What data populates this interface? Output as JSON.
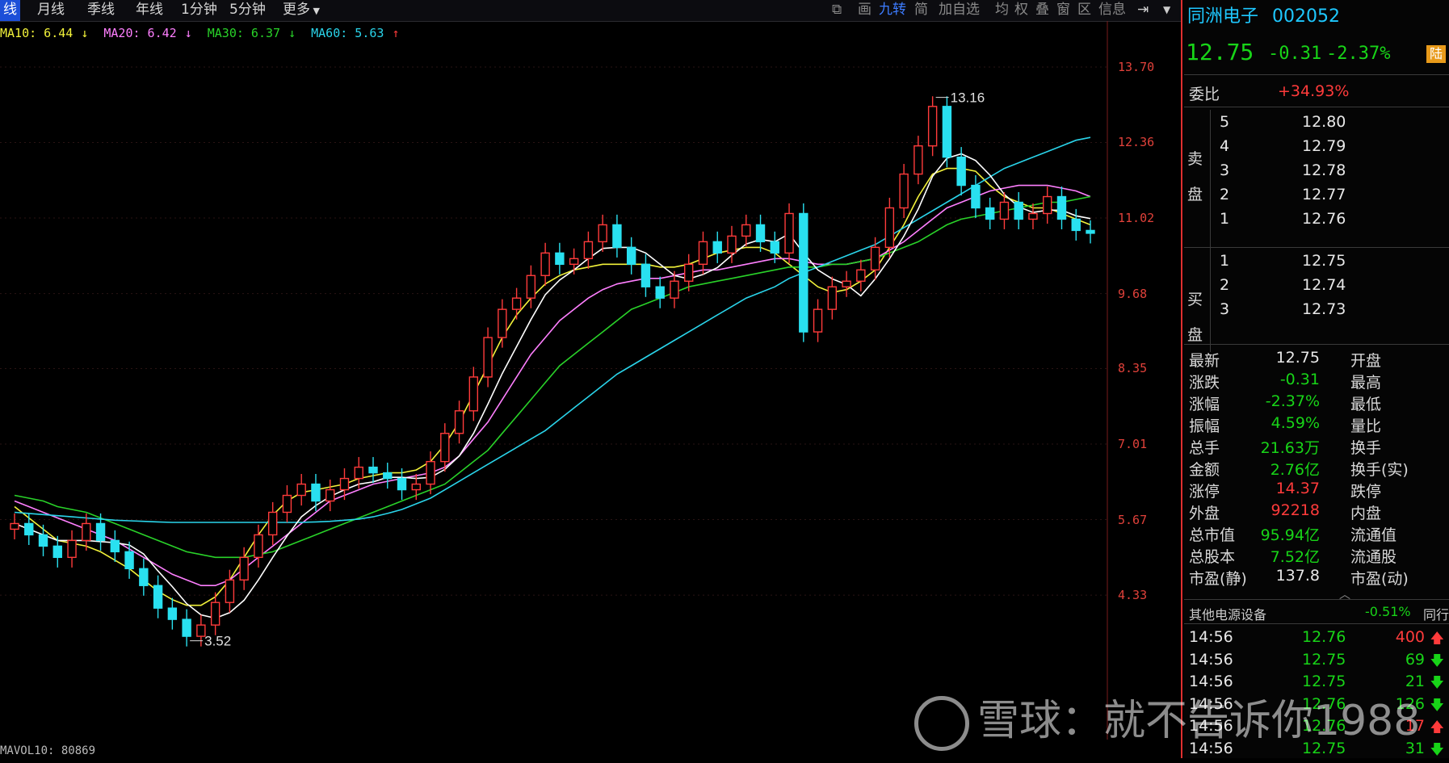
{
  "toolbar": {
    "tabs": [
      "线",
      "月线",
      "季线",
      "年线",
      "1分钟",
      "5分钟",
      "更多"
    ],
    "tools": [
      "画",
      "九转",
      "简",
      "加自选",
      "均",
      "权",
      "叠",
      "窗",
      "区",
      "信息"
    ]
  },
  "ma_legend": [
    {
      "label": "MA10: 6.44",
      "color": "#f2f23a"
    },
    {
      "label": "MA20: 6.42",
      "color": "#ff7fff"
    },
    {
      "label": "MA30: 6.37",
      "color": "#29d229"
    },
    {
      "label": "MA60: 5.63",
      "color": "#2ad4ea"
    }
  ],
  "vol_legend": "MAVOL10: 80869",
  "chart_data": {
    "type": "candlestick",
    "ylim": [
      3.2,
      14.0
    ],
    "yticks": [
      "13.70",
      "12.36",
      "11.02",
      "9.68",
      "8.35",
      "7.01",
      "5.67",
      "4.33"
    ],
    "high_label": "13.16",
    "low_label": "3.52",
    "close": [
      5.6,
      5.4,
      5.2,
      5.0,
      5.3,
      5.6,
      5.3,
      5.1,
      4.8,
      4.5,
      4.1,
      3.9,
      3.6,
      3.8,
      4.2,
      4.6,
      5.0,
      5.4,
      5.8,
      6.1,
      6.3,
      6.0,
      6.2,
      6.4,
      6.6,
      6.5,
      6.4,
      6.2,
      6.3,
      6.7,
      7.2,
      7.6,
      8.2,
      8.9,
      9.4,
      9.6,
      10.0,
      10.4,
      10.2,
      10.3,
      10.6,
      10.9,
      10.5,
      10.2,
      9.8,
      9.6,
      9.9,
      10.2,
      10.6,
      10.4,
      10.7,
      10.9,
      10.6,
      10.4,
      11.1,
      9.0,
      9.4,
      9.8,
      9.9,
      10.1,
      10.5,
      11.2,
      11.8,
      12.3,
      13.0,
      12.1,
      11.6,
      11.2,
      11.0,
      11.3,
      11.0,
      11.1,
      11.4,
      11.0,
      10.8,
      10.75
    ],
    "ma10": [
      5.9,
      5.7,
      5.5,
      5.3,
      5.25,
      5.2,
      5.1,
      4.95,
      4.8,
      4.6,
      4.4,
      4.25,
      4.15,
      4.15,
      4.3,
      4.6,
      5.0,
      5.4,
      5.75,
      6.0,
      6.15,
      6.2,
      6.25,
      6.3,
      6.4,
      6.45,
      6.5,
      6.5,
      6.55,
      6.7,
      7.0,
      7.4,
      7.9,
      8.4,
      8.9,
      9.3,
      9.6,
      9.85,
      10.0,
      10.1,
      10.15,
      10.2,
      10.2,
      10.2,
      10.2,
      10.15,
      10.15,
      10.2,
      10.3,
      10.4,
      10.45,
      10.5,
      10.5,
      10.4,
      10.2,
      10.0,
      9.8,
      9.7,
      9.75,
      9.9,
      10.1,
      10.5,
      10.9,
      11.4,
      11.8,
      11.9,
      11.9,
      11.85,
      11.6,
      11.4,
      11.3,
      11.2,
      11.2,
      11.1,
      11.0,
      10.9
    ],
    "ma20": [
      6.0,
      5.9,
      5.8,
      5.7,
      5.6,
      5.5,
      5.4,
      5.3,
      5.15,
      5.0,
      4.85,
      4.7,
      4.6,
      4.5,
      4.5,
      4.6,
      4.8,
      5.0,
      5.2,
      5.4,
      5.6,
      5.8,
      6.0,
      6.1,
      6.2,
      6.3,
      6.35,
      6.4,
      6.45,
      6.5,
      6.6,
      6.8,
      7.1,
      7.4,
      7.8,
      8.2,
      8.6,
      8.9,
      9.2,
      9.4,
      9.6,
      9.75,
      9.85,
      9.9,
      9.95,
      9.95,
      10.0,
      10.05,
      10.1,
      10.1,
      10.15,
      10.2,
      10.25,
      10.3,
      10.3,
      10.25,
      10.2,
      10.2,
      10.2,
      10.25,
      10.3,
      10.45,
      10.6,
      10.8,
      11.0,
      11.2,
      11.3,
      11.4,
      11.5,
      11.55,
      11.6,
      11.6,
      11.6,
      11.55,
      11.5,
      11.4
    ],
    "ma30": [
      6.1,
      6.05,
      6.0,
      5.9,
      5.85,
      5.8,
      5.7,
      5.6,
      5.5,
      5.4,
      5.3,
      5.2,
      5.1,
      5.05,
      5.0,
      5.0,
      5.0,
      5.05,
      5.1,
      5.2,
      5.3,
      5.4,
      5.5,
      5.6,
      5.7,
      5.8,
      5.9,
      6.0,
      6.1,
      6.2,
      6.3,
      6.5,
      6.7,
      6.9,
      7.2,
      7.5,
      7.8,
      8.1,
      8.4,
      8.6,
      8.8,
      9.0,
      9.2,
      9.4,
      9.5,
      9.6,
      9.7,
      9.8,
      9.85,
      9.9,
      9.95,
      10.0,
      10.05,
      10.1,
      10.15,
      10.15,
      10.15,
      10.2,
      10.2,
      10.25,
      10.3,
      10.4,
      10.5,
      10.6,
      10.75,
      10.9,
      11.0,
      11.05,
      11.1,
      11.15,
      11.2,
      11.25,
      11.3,
      11.3,
      11.35,
      11.4
    ],
    "ma60": [
      5.8,
      5.78,
      5.76,
      5.74,
      5.72,
      5.7,
      5.68,
      5.66,
      5.65,
      5.64,
      5.63,
      5.62,
      5.62,
      5.62,
      5.62,
      5.62,
      5.62,
      5.62,
      5.62,
      5.62,
      5.62,
      5.63,
      5.64,
      5.66,
      5.68,
      5.72,
      5.78,
      5.85,
      5.95,
      6.05,
      6.2,
      6.35,
      6.5,
      6.65,
      6.8,
      6.95,
      7.1,
      7.25,
      7.45,
      7.65,
      7.85,
      8.05,
      8.25,
      8.4,
      8.55,
      8.7,
      8.85,
      9.0,
      9.15,
      9.3,
      9.45,
      9.6,
      9.7,
      9.8,
      9.95,
      10.05,
      10.15,
      10.25,
      10.35,
      10.45,
      10.55,
      10.7,
      10.85,
      11.0,
      11.15,
      11.3,
      11.45,
      11.6,
      11.75,
      11.9,
      12.0,
      12.1,
      12.2,
      12.3,
      12.4,
      12.45
    ]
  },
  "panel": {
    "stock_name": "同洲电子",
    "stock_code": "002052",
    "price": "12.75",
    "change": "-0.31",
    "change_pct": "-2.37%",
    "badge": "陆",
    "weibi_label": "委比",
    "weibi_value": "+34.93%",
    "sell_label_1": "卖",
    "sell_label_2": "盘",
    "buy_label_1": "买",
    "buy_label_2": "盘",
    "sell": [
      {
        "idx": "5",
        "price": "12.80"
      },
      {
        "idx": "4",
        "price": "12.79"
      },
      {
        "idx": "3",
        "price": "12.78"
      },
      {
        "idx": "2",
        "price": "12.77"
      },
      {
        "idx": "1",
        "price": "12.76"
      }
    ],
    "buy": [
      {
        "idx": "1",
        "price": "12.75"
      },
      {
        "idx": "2",
        "price": "12.74"
      },
      {
        "idx": "3",
        "price": "12.73"
      }
    ],
    "stats": [
      {
        "l": "最新",
        "v": "12.75",
        "c": "white",
        "r": "开盘"
      },
      {
        "l": "涨跌",
        "v": "-0.31",
        "c": "green",
        "r": "最高"
      },
      {
        "l": "涨幅",
        "v": "-2.37%",
        "c": "green",
        "r": "最低"
      },
      {
        "l": "振幅",
        "v": "4.59%",
        "c": "green",
        "r": "量比"
      },
      {
        "l": "总手",
        "v": "21.63万",
        "c": "green",
        "r": "换手"
      },
      {
        "l": "金额",
        "v": "2.76亿",
        "c": "green",
        "r": "换手(实)"
      },
      {
        "l": "涨停",
        "v": "14.37",
        "c": "red",
        "r": "跌停"
      },
      {
        "l": "外盘",
        "v": "92218",
        "c": "red",
        "r": "内盘"
      },
      {
        "l": "总市值",
        "v": "95.94亿",
        "c": "green",
        "r": "流通值"
      },
      {
        "l": "总股本",
        "v": "7.52亿",
        "c": "green",
        "r": "流通股"
      },
      {
        "l": "市盈(静)",
        "v": "137.8",
        "c": "white",
        "r": "市盈(动)"
      }
    ],
    "sector_name": "其他电源设备",
    "sector_pct": "-0.51%",
    "sector_tab": "同行",
    "ticks": [
      {
        "t": "14:56",
        "p": "12.76",
        "v": "400",
        "dir": "up"
      },
      {
        "t": "14:56",
        "p": "12.75",
        "v": "69",
        "dir": "down"
      },
      {
        "t": "14:56",
        "p": "12.75",
        "v": "21",
        "dir": "down"
      },
      {
        "t": "14:56",
        "p": "12.76",
        "v": "126",
        "dir": "down"
      },
      {
        "t": "14:56",
        "p": "12.76",
        "v": "17",
        "dir": "up"
      },
      {
        "t": "14:56",
        "p": "12.75",
        "v": "31",
        "dir": "down"
      }
    ]
  },
  "watermark": "雪球：就不告诉你1988"
}
